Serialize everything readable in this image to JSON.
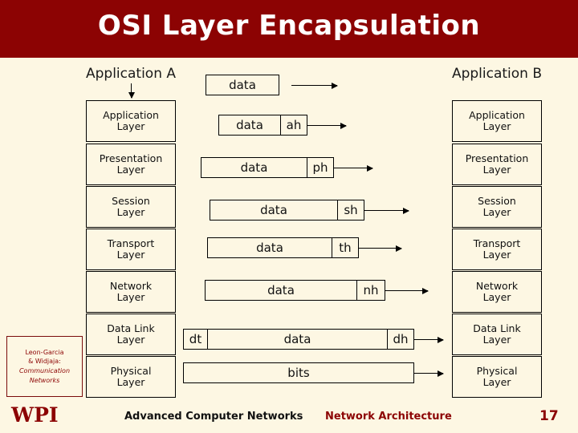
{
  "title": "OSI Layer Encapsulation",
  "endpoints": {
    "left": "Application A",
    "right": "Application B"
  },
  "layers": [
    {
      "line1": "Application",
      "line2": "Layer"
    },
    {
      "line1": "Presentation",
      "line2": "Layer"
    },
    {
      "line1": "Session",
      "line2": "Layer"
    },
    {
      "line1": "Transport",
      "line2": "Layer"
    },
    {
      "line1": "Network",
      "line2": "Layer"
    },
    {
      "line1": "Data Link",
      "line2": "Layer"
    },
    {
      "line1": "Physical",
      "line2": "Layer"
    }
  ],
  "pdus": [
    {
      "data": "data",
      "trailer": "",
      "leader": ""
    },
    {
      "data": "data",
      "trailer": "ah",
      "leader": ""
    },
    {
      "data": "data",
      "trailer": "ph",
      "leader": ""
    },
    {
      "data": "data",
      "trailer": "sh",
      "leader": ""
    },
    {
      "data": "data",
      "trailer": "th",
      "leader": ""
    },
    {
      "data": "data",
      "trailer": "nh",
      "leader": ""
    },
    {
      "data": "data",
      "trailer": "dh",
      "leader": "dt"
    },
    {
      "data": "bits",
      "trailer": "",
      "leader": ""
    }
  ],
  "credit": {
    "line1": "Leon-Garcia",
    "line2": "& Widjaja:",
    "line3": "Communication",
    "line4": "Networks"
  },
  "logo": "WPI",
  "footer": {
    "left": "Advanced Computer Networks",
    "right": "Network Architecture",
    "slide_number": "17"
  },
  "colors": {
    "brand": "#8c0303",
    "background": "#fdf7e3",
    "title_text": "#ffffff"
  }
}
